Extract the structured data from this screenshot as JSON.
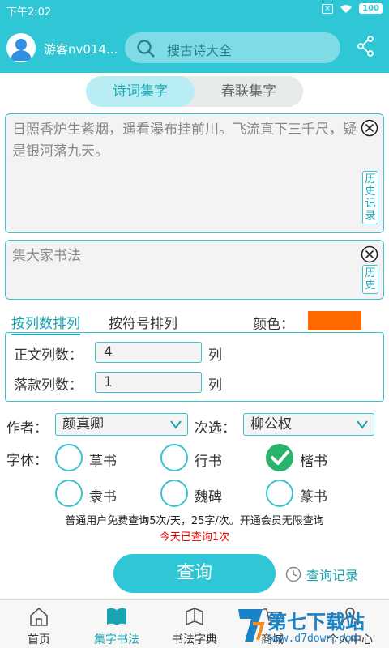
{
  "status_bar": {
    "time": "下午2:02",
    "battery": "100"
  },
  "header": {
    "user_name": "游客nv014...",
    "search_placeholder": "搜古诗大全"
  },
  "tabs": [
    {
      "label": "诗词集字"
    },
    {
      "label": "春联集字"
    }
  ],
  "poem_box": {
    "text": "日照香炉生紫烟，遥看瀑布挂前川。飞流直下三千尺，疑是银河落九天。",
    "history_label": "历史记录"
  },
  "title_box": {
    "text": "集大家书法",
    "history_label": "历史"
  },
  "sort": {
    "by_column": "按列数排列",
    "by_symbol": "按符号排列",
    "color_label": "颜色：",
    "color_value": "#ff6a00"
  },
  "columns": {
    "body_label": "正文列数：",
    "body_value": "4",
    "body_unit": "列",
    "sign_label": "落款列数：",
    "sign_value": "1",
    "sign_unit": "列"
  },
  "author": {
    "label": "作者：",
    "value": "颜真卿"
  },
  "secondary": {
    "label": "次选：",
    "value": "柳公权"
  },
  "fonts": {
    "label": "字体：",
    "options": [
      {
        "label": "草书"
      },
      {
        "label": "行书"
      },
      {
        "label": "楷书"
      },
      {
        "label": "隶书"
      },
      {
        "label": "魏碑"
      },
      {
        "label": "篆书"
      }
    ],
    "selected": "楷书"
  },
  "notice": "普通用户免费查询5次/天，25字/次。开通会员无限查询",
  "count_notice": "今天已查询1次",
  "query_button": "查询",
  "records_link": "查询记录",
  "bottom_nav": [
    {
      "label": "首页"
    },
    {
      "label": "集字书法"
    },
    {
      "label": "书法字典"
    },
    {
      "label": "商城"
    },
    {
      "label": "个人中心"
    }
  ],
  "watermark": {
    "text": "第七下载站",
    "url": "www.d7down.com"
  },
  "colors": {
    "accent": "#2fc6d6",
    "selected_radio": "#2ab36a"
  }
}
